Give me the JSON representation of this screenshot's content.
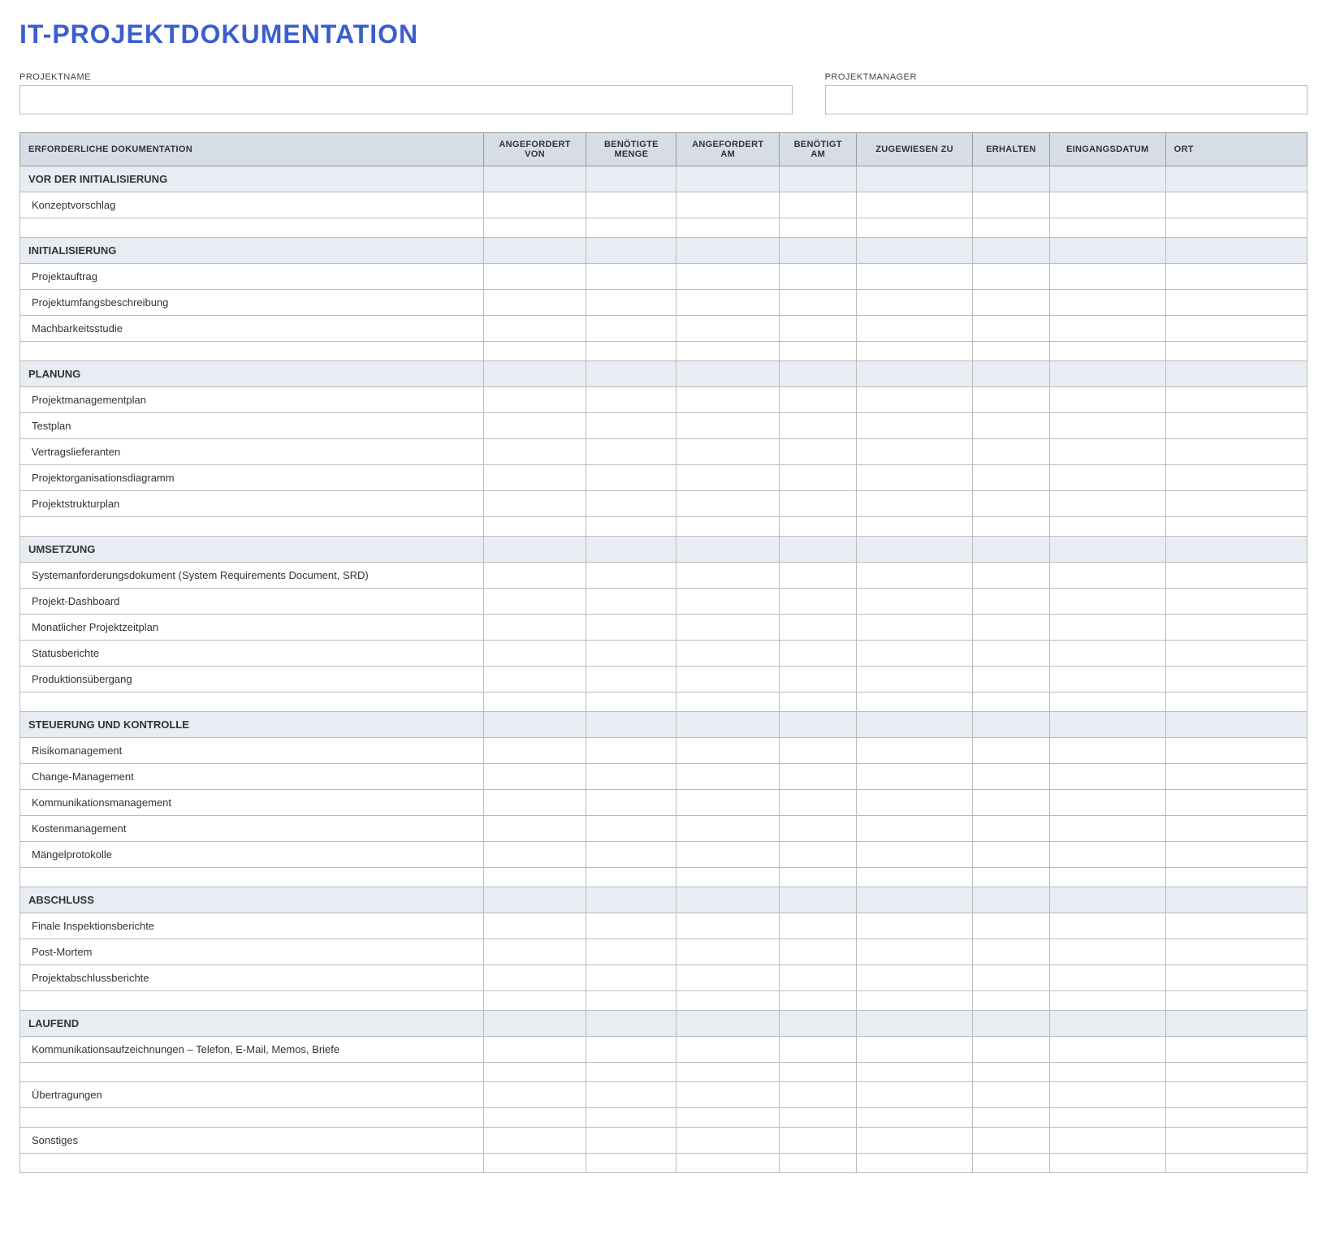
{
  "title": "IT-PROJEKTDOKUMENTATION",
  "meta": {
    "projectNameLabel": "PROJEKTNAME",
    "projectManagerLabel": "PROJEKTMANAGER",
    "projectNameValue": "",
    "projectManagerValue": ""
  },
  "columns": [
    "ERFORDERLICHE DOKUMENTATION",
    "ANGEFORDERT VON",
    "BENÖTIGTE MENGE",
    "ANGEFORDERT AM",
    "BENÖTIGT AM",
    "ZUGEWIESEN ZU",
    "ERHALTEN",
    "EINGANGSDATUM",
    "ORT"
  ],
  "sections": [
    {
      "title": "VOR DER INITIALISIERUNG",
      "items": [
        "Konzeptvorschlag"
      ],
      "trailingBlanks": 1
    },
    {
      "title": "INITIALISIERUNG",
      "items": [
        "Projektauftrag",
        "Projektumfangsbeschreibung",
        "Machbarkeitsstudie"
      ],
      "trailingBlanks": 1
    },
    {
      "title": "PLANUNG",
      "items": [
        "Projektmanagementplan",
        "Testplan",
        "Vertragslieferanten",
        "Projektorganisationsdiagramm",
        "Projektstrukturplan"
      ],
      "trailingBlanks": 1
    },
    {
      "title": "UMSETZUNG",
      "items": [
        "Systemanforderungsdokument (System Requirements Document, SRD)",
        "Projekt-Dashboard",
        "Monatlicher Projektzeitplan",
        "Statusberichte",
        "Produktionsübergang"
      ],
      "trailingBlanks": 1
    },
    {
      "title": "STEUERUNG UND KONTROLLE",
      "items": [
        "Risikomanagement",
        "Change-Management",
        "Kommunikationsmanagement",
        "Kostenmanagement",
        "Mängelprotokolle"
      ],
      "trailingBlanks": 1
    },
    {
      "title": "ABSCHLUSS",
      "items": [
        "Finale Inspektionsberichte",
        "Post-Mortem",
        "Projektabschlussberichte"
      ],
      "trailingBlanks": 1
    },
    {
      "title": "LAUFEND",
      "items": [
        "Kommunikationsaufzeichnungen – Telefon, E-Mail, Memos, Briefe",
        "",
        "Übertragungen",
        "",
        "Sonstiges",
        ""
      ],
      "trailingBlanks": 0
    }
  ]
}
